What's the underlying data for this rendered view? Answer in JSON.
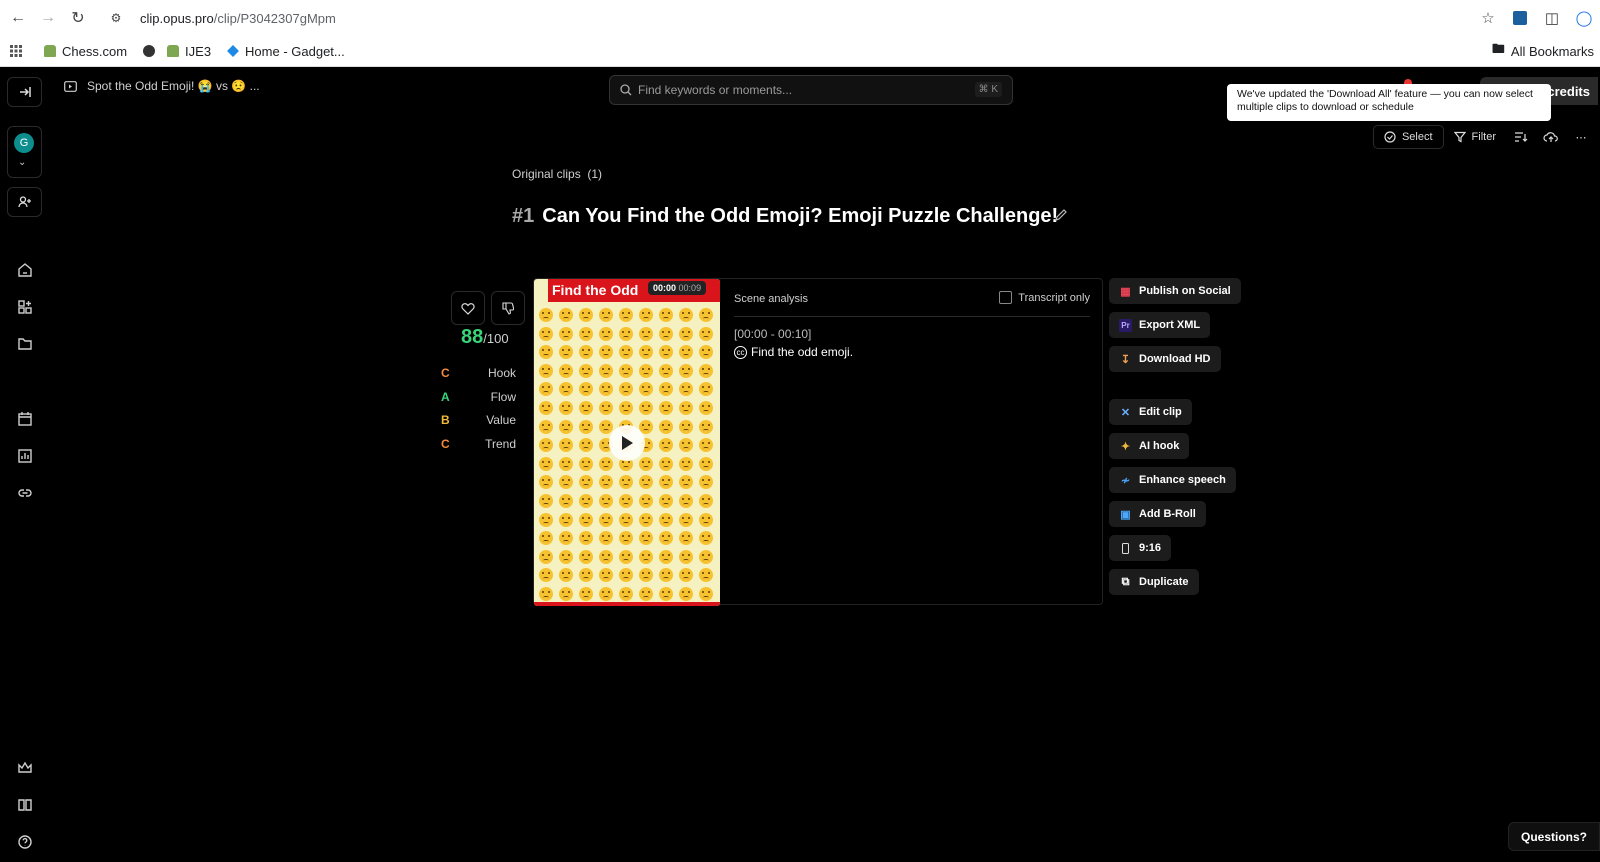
{
  "browser": {
    "url_host": "clip.opus.pro",
    "url_path": "/clip/P3042307gMpm",
    "bookmarks": [
      "Chess.com",
      "IJE3",
      "Home - Gadget..."
    ],
    "all_bookmarks": "All Bookmarks"
  },
  "header": {
    "project_title": "Spot the Odd Emoji! 😭 vs 😟 ...",
    "search_placeholder": "Find keywords or moments...",
    "search_shortcut": "⌘ K",
    "credits_label": "credits",
    "tooltip": "We've updated the 'Download All' feature — you can now select multiple clips to download or schedule"
  },
  "toolbar": {
    "select_label": "Select",
    "filter_label": "Filter"
  },
  "sidebar": {
    "avatar_letter": "G"
  },
  "main": {
    "section_label": "Original clips",
    "section_count": "(1)",
    "clip_number": "#1",
    "clip_title": "Can You Find the Odd Emoji? Emoji Puzzle Challenge!",
    "score_value": "88",
    "score_max": "/100",
    "grades": [
      {
        "grade": "C",
        "name": "Hook",
        "color": "#f08a3c"
      },
      {
        "grade": "A",
        "name": "Flow",
        "color": "#39d47a"
      },
      {
        "grade": "B",
        "name": "Value",
        "color": "#f0b93c"
      },
      {
        "grade": "C",
        "name": "Trend",
        "color": "#f08a3c"
      }
    ]
  },
  "video": {
    "overlay_text": "Find the Odd",
    "time_current": "00:00",
    "time_total": "00:09"
  },
  "scene": {
    "heading": "Scene analysis",
    "transcript_only_label": "Transcript only",
    "timestamp": "[00:00 - 00:10]",
    "caption": "Find the odd emoji."
  },
  "actions": {
    "publish": "Publish on Social",
    "export_xml": "Export XML",
    "download_hd": "Download HD",
    "edit_clip": "Edit clip",
    "ai_hook": "AI hook",
    "enhance_speech": "Enhance speech",
    "add_broll": "Add B-Roll",
    "aspect": "9:16",
    "duplicate": "Duplicate"
  },
  "footer": {
    "questions": "Questions?"
  }
}
